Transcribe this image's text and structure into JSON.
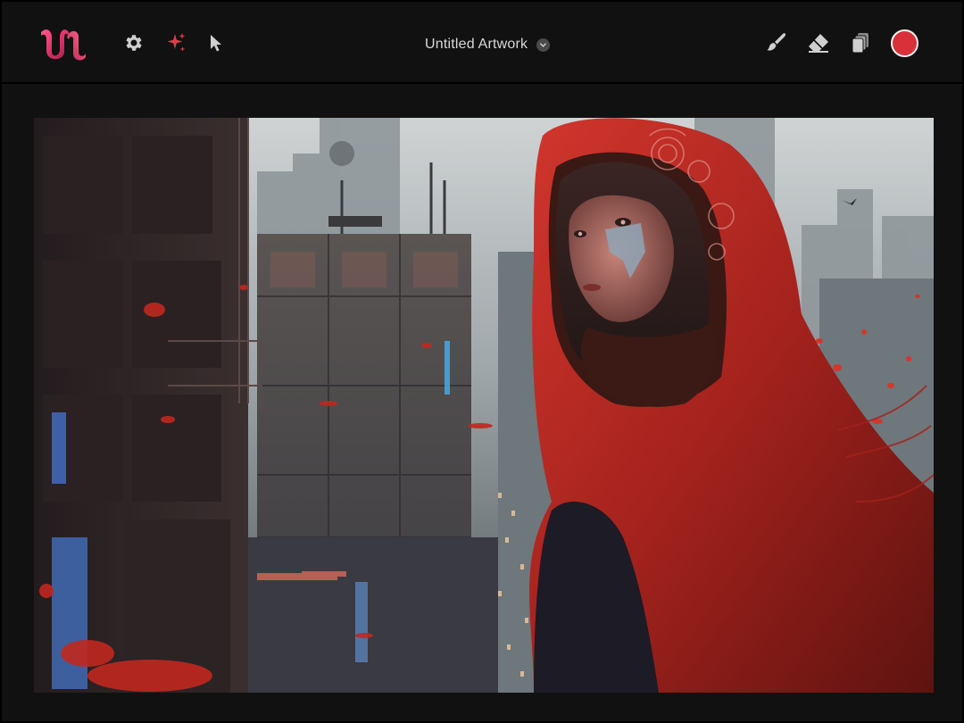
{
  "app": {
    "logo_icon": "brand-logo-icon",
    "colors": {
      "background": "#121212",
      "topbar": "#111111",
      "accent_red": "#d9303a",
      "logo_pink": "#e8467a",
      "icon_gray": "#cfcfcf"
    }
  },
  "toolbar": {
    "left_tools": [
      {
        "icon": "gear-icon",
        "label": "Settings"
      },
      {
        "icon": "sparkle-icon",
        "label": "AI Generate"
      },
      {
        "icon": "cursor-icon",
        "label": "Select"
      }
    ],
    "right_tools": [
      {
        "icon": "brush-icon",
        "label": "Brush"
      },
      {
        "icon": "eraser-icon",
        "label": "Eraser"
      },
      {
        "icon": "layers-icon",
        "label": "Layers"
      }
    ],
    "current_color": "#d9303a"
  },
  "document": {
    "title": "Untitled Artwork",
    "title_chevron_icon": "chevron-down-icon"
  },
  "canvas": {
    "artwork_subject": "artwork-image"
  }
}
